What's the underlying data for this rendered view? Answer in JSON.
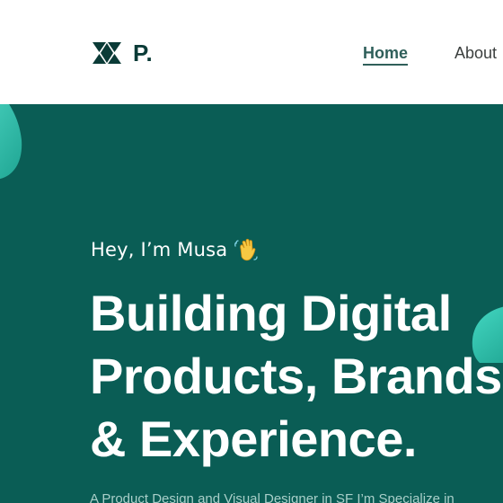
{
  "header": {
    "logo_text": "P.",
    "logo_icon": "triangles-logo-icon",
    "nav": [
      {
        "label": "Home",
        "active": true
      },
      {
        "label": "About",
        "active": false
      }
    ]
  },
  "hero": {
    "greeting": "Hey, I’m Musa",
    "greeting_icon": "waving-hand-icon",
    "headline_lines": [
      "Building Digital",
      "Products, Brands",
      "& Experience."
    ],
    "subtext": "A Product Design and Visual Designer in SF I’m Specialize in"
  },
  "colors": {
    "header_bg": "#ffffff",
    "hero_bg": "#0a5d55",
    "accent_mint": "#3fd3bf",
    "logo_dark": "#0b3b37"
  }
}
